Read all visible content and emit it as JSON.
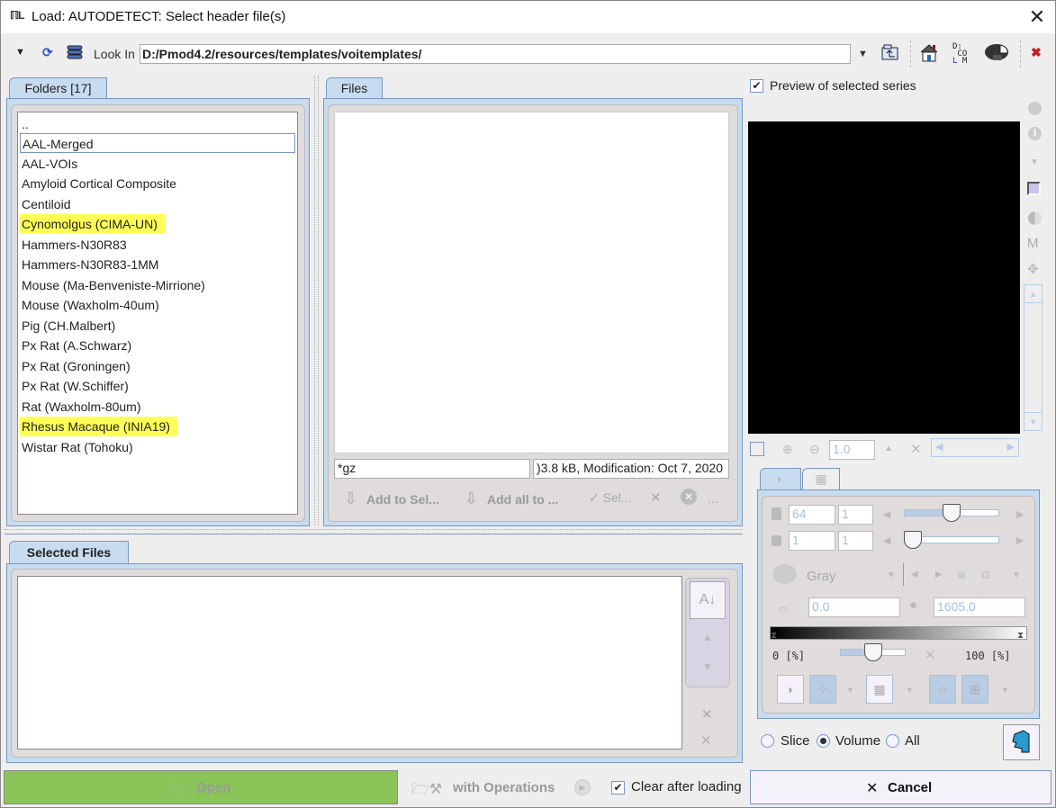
{
  "window": {
    "title": "Load: AUTODETECT: Select header file(s)",
    "app_icon": "pmod-logo-icon",
    "close_icon": "close-icon"
  },
  "toolbar": {
    "look_in_label": "Look In",
    "path": "D:/Pmod4.2/resources/templates/voitemplates/",
    "icons": [
      "menu-dropdown-icon",
      "refresh-icon",
      "database-icon",
      "path-dropdown-icon",
      "folder-up-icon",
      "home-icon",
      "dicom-icon",
      "brain-icon",
      "remove-red-icon"
    ]
  },
  "folders": {
    "tab_label": "Folders [17]",
    "items": [
      {
        "label": "..",
        "highlight": false,
        "selected": false
      },
      {
        "label": "AAL-Merged",
        "highlight": false,
        "selected": true
      },
      {
        "label": "AAL-VOIs",
        "highlight": false,
        "selected": false
      },
      {
        "label": "Amyloid Cortical Composite",
        "highlight": false,
        "selected": false
      },
      {
        "label": "Centiloid",
        "highlight": false,
        "selected": false
      },
      {
        "label": "Cynomolgus (CIMA-UN)",
        "highlight": true,
        "selected": false
      },
      {
        "label": "Hammers-N30R83",
        "highlight": false,
        "selected": false
      },
      {
        "label": "Hammers-N30R83-1MM",
        "highlight": false,
        "selected": false
      },
      {
        "label": "Mouse (Ma-Benveniste-Mirrione)",
        "highlight": false,
        "selected": false
      },
      {
        "label": "Mouse (Waxholm-40um)",
        "highlight": false,
        "selected": false
      },
      {
        "label": "Pig (CH.Malbert)",
        "highlight": false,
        "selected": false
      },
      {
        "label": "Px Rat (A.Schwarz)",
        "highlight": false,
        "selected": false
      },
      {
        "label": "Px Rat (Groningen)",
        "highlight": false,
        "selected": false
      },
      {
        "label": "Px Rat (W.Schiffer)",
        "highlight": false,
        "selected": false
      },
      {
        "label": "Rat (Waxholm-80um)",
        "highlight": false,
        "selected": false
      },
      {
        "label": "Rhesus Macaque (INIA19)",
        "highlight": true,
        "selected": false
      },
      {
        "label": "Wistar Rat (Tohoku)",
        "highlight": false,
        "selected": false
      }
    ]
  },
  "files": {
    "tab_label": "Files",
    "filter": "*gz",
    "info": ")3.8 kB,  Modification: Oct 7, 2020",
    "add_to_sel": "Add to Sel...",
    "add_all": "Add all to ...",
    "sel": "Sel...",
    "clear_symbol": "✕",
    "more": "..."
  },
  "selected": {
    "tab_label": "Selected Files"
  },
  "preview": {
    "checkbox_label": "Preview of selected series",
    "checked": true,
    "zoom_value": "1.0",
    "slice_value": "64",
    "slice_step": "1",
    "frame_value": "1",
    "frame_step": "1",
    "slice_slider_fraction": 0.5,
    "frame_slider_fraction": 0.0,
    "colormap": "Gray",
    "min_value": "0.0",
    "max_value": "1605.0",
    "pct_min": "0 [%]",
    "pct_max": "100 [%]",
    "pct_slider_fraction": 0.5,
    "mode_options": [
      "Slice",
      "Volume",
      "All"
    ],
    "mode_selected": "Volume"
  },
  "bottom": {
    "open_label": "Open",
    "with_operations_label": "with Operations",
    "clear_after_loading_label": "Clear after loading",
    "clear_after_loading_checked": true,
    "cancel_label": "Cancel",
    "open_color": "#8bc55a"
  }
}
